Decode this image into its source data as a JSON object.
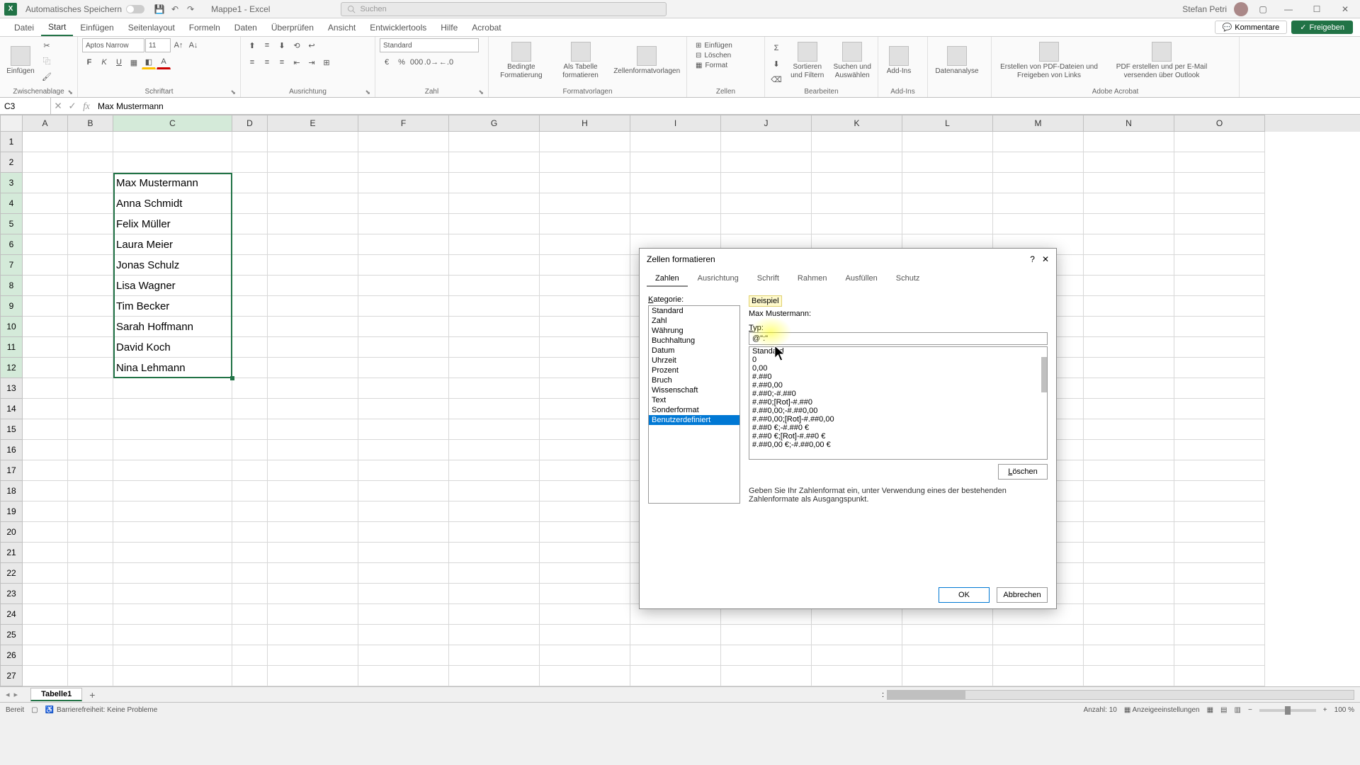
{
  "titlebar": {
    "autosave_label": "Automatisches Speichern",
    "doc_title": "Mappe1 - Excel",
    "search_placeholder": "Suchen",
    "user_name": "Stefan Petri"
  },
  "tabs": {
    "file": "Datei",
    "items": [
      "Start",
      "Einfügen",
      "Seitenlayout",
      "Formeln",
      "Daten",
      "Überprüfen",
      "Ansicht",
      "Entwicklertools",
      "Hilfe",
      "Acrobat"
    ],
    "active_index": 0,
    "comments": "Kommentare",
    "share": "Freigeben"
  },
  "ribbon": {
    "groups": {
      "clipboard": {
        "paste": "Einfügen",
        "label": "Zwischenablage"
      },
      "font": {
        "name": "Aptos Narrow",
        "size": "11",
        "label": "Schriftart"
      },
      "align": {
        "label": "Ausrichtung"
      },
      "number": {
        "format": "Standard",
        "label": "Zahl"
      },
      "styles": {
        "cond": "Bedingte Formatierung",
        "table": "Als Tabelle formatieren",
        "cell": "Zellenformatvorlagen",
        "label": "Formatvorlagen"
      },
      "cells": {
        "insert": "Einfügen",
        "delete": "Löschen",
        "format": "Format",
        "label": "Zellen"
      },
      "editing": {
        "sort": "Sortieren und Filtern",
        "find": "Suchen und Auswählen",
        "label": "Bearbeiten"
      },
      "addins": {
        "btn": "Add-Ins",
        "label": "Add-Ins"
      },
      "analyze": {
        "btn": "Datenanalyse"
      },
      "acrobat": {
        "btn1": "Erstellen von PDF-Dateien und Freigeben von Links",
        "btn2": "PDF erstellen und per E-Mail versenden über Outlook",
        "label": "Adobe Acrobat"
      }
    }
  },
  "formula": {
    "cell_ref": "C3",
    "value": "Max Mustermann"
  },
  "columns": [
    "A",
    "B",
    "C",
    "D",
    "E",
    "F",
    "G",
    "H",
    "I",
    "J",
    "K",
    "L",
    "M",
    "N",
    "O"
  ],
  "cell_data": {
    "3": "Max Mustermann",
    "4": "Anna Schmidt",
    "5": "Felix Müller",
    "6": "Laura Meier",
    "7": "Jonas Schulz",
    "8": "Lisa Wagner",
    "9": "Tim Becker",
    "10": "Sarah Hoffmann",
    "11": "David Koch",
    "12": "Nina Lehmann"
  },
  "sheet": {
    "name": "Tabelle1"
  },
  "status": {
    "ready": "Bereit",
    "a11y": "Barrierefreiheit: Keine Probleme",
    "count_label": "Anzahl:",
    "count_value": "10",
    "display": "Anzeigeeinstellungen",
    "zoom": "100 %"
  },
  "dialog": {
    "title": "Zellen formatieren",
    "tabs": [
      "Zahlen",
      "Ausrichtung",
      "Schrift",
      "Rahmen",
      "Ausfüllen",
      "Schutz"
    ],
    "active_tab": 0,
    "category_label": "Kategorie:",
    "categories": [
      "Standard",
      "Zahl",
      "Währung",
      "Buchhaltung",
      "Datum",
      "Uhrzeit",
      "Prozent",
      "Bruch",
      "Wissenschaft",
      "Text",
      "Sonderformat",
      "Benutzerdefiniert"
    ],
    "selected_category": 11,
    "preview_label": "Beispiel",
    "preview_value": "Max Mustermann:",
    "type_label": "Typ:",
    "type_value": "@\":\"",
    "formats": [
      "Standard",
      "0",
      "0,00",
      "#.##0",
      "#.##0,00",
      "#.##0;-#.##0",
      "#.##0;[Rot]-#.##0",
      "#.##0,00;-#.##0,00",
      "#.##0,00;[Rot]-#.##0,00",
      "#.##0 €;-#.##0 €",
      "#.##0 €;[Rot]-#.##0 €",
      "#.##0,00 €;-#.##0,00 €"
    ],
    "delete_btn": "Löschen",
    "hint": "Geben Sie Ihr Zahlenformat ein, unter Verwendung eines der bestehenden Zahlenformate als Ausgangspunkt.",
    "ok": "OK",
    "cancel": "Abbrechen"
  }
}
